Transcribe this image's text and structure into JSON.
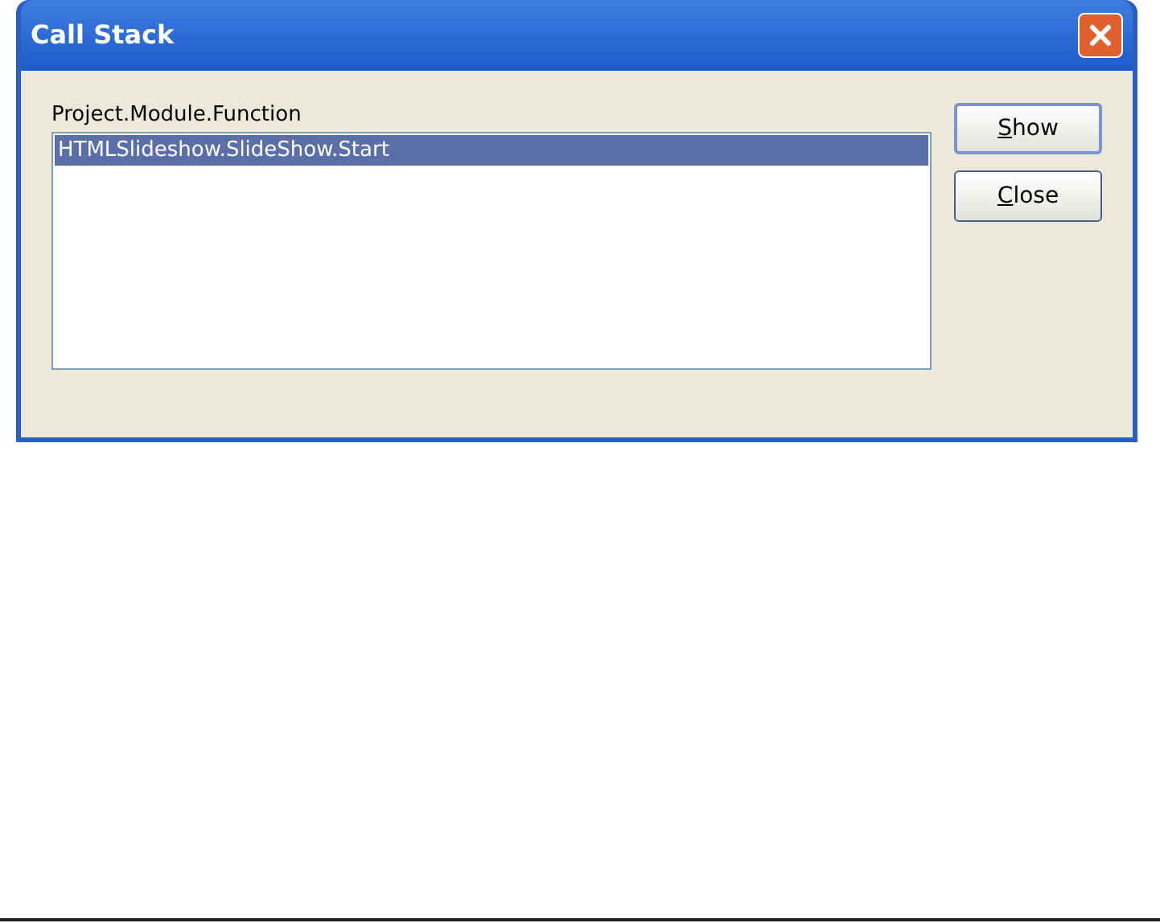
{
  "window": {
    "title": "Call Stack"
  },
  "list": {
    "label": "Project.Module.Function",
    "items": [
      {
        "text": "HTMLSlideshow.SlideShow.Start",
        "selected": true
      }
    ]
  },
  "buttons": [
    {
      "label": "Show",
      "underline_first": true,
      "default": true
    },
    {
      "label": "Close",
      "underline_first": true,
      "default": false
    }
  ]
}
